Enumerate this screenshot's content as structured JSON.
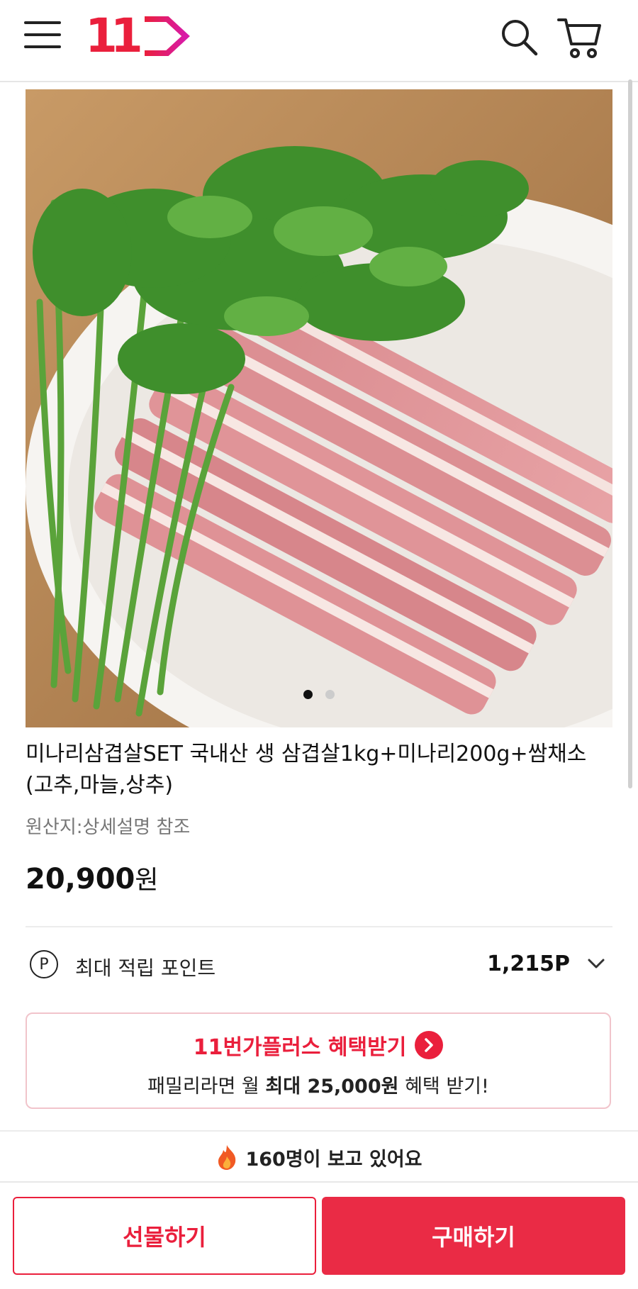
{
  "header": {
    "logo_text": "11",
    "icons": [
      "menu-icon",
      "logo-icon",
      "search-icon",
      "cart-icon"
    ]
  },
  "product": {
    "title": "미나리삼겹살SET 국내산 생 삼겹살1kg+미나리200g+쌈채소(고추,마늘,상추)",
    "origin": "원산지:상세설명 참조",
    "price": "20,900",
    "price_unit": "원",
    "image_count": 2,
    "active_image": 1
  },
  "points": {
    "icon_letter": "P",
    "label": "최대 적립 포인트",
    "value": "1,215P"
  },
  "plus": {
    "title": "11번가플러스 혜택받기",
    "sub_prefix": "패밀리라면 월 ",
    "sub_bold": "최대 25,000원",
    "sub_suffix": " 혜택 받기!"
  },
  "viewers": {
    "icon": "fire-icon",
    "text": "160명이 보고 있어요"
  },
  "actions": {
    "gift_label": "선물하기",
    "buy_label": "구매하기"
  },
  "colors": {
    "brand": "#ea1f3c",
    "buy_button": "#ea2b45",
    "plus_border": "#f1c4cb"
  }
}
